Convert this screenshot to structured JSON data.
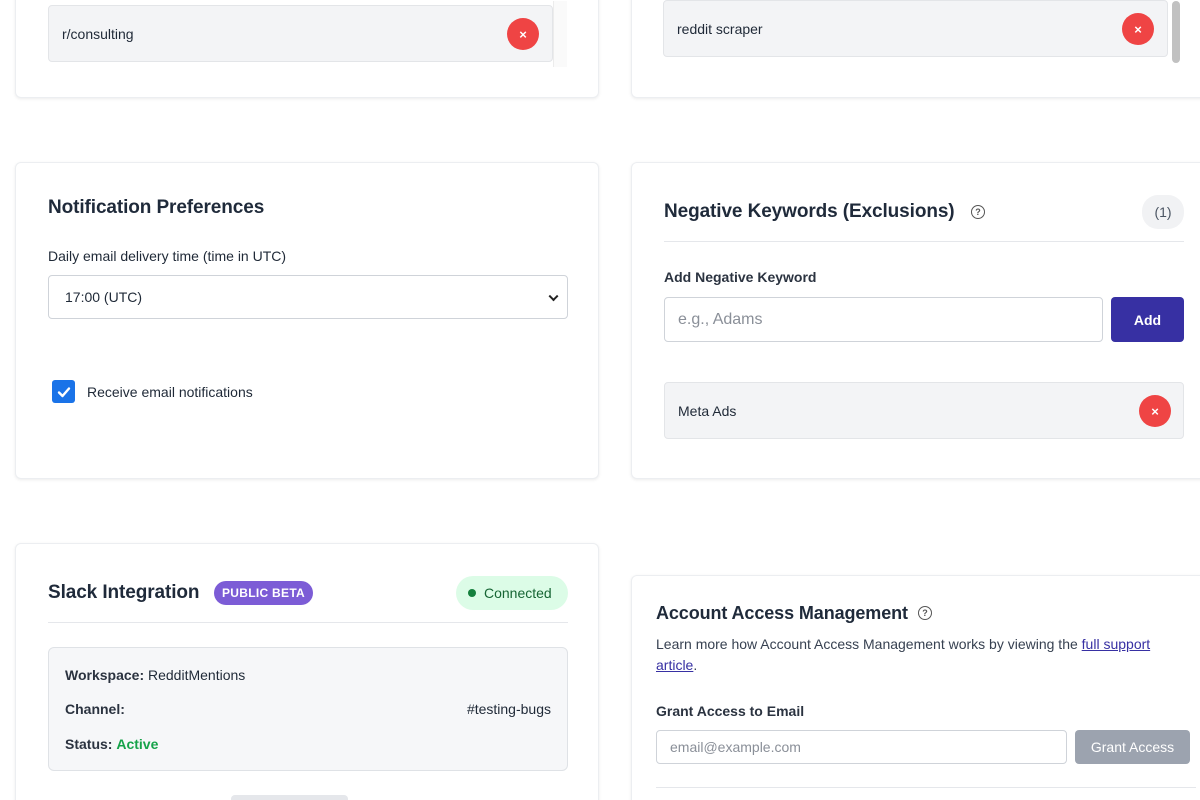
{
  "subreddits": {
    "item": "r/consulting",
    "remove_icon": "×"
  },
  "keywords": {
    "item": "reddit scraper",
    "remove_icon": "×"
  },
  "notifications": {
    "title": "Notification Preferences",
    "time_label": "Daily email delivery time (time in UTC)",
    "time_value": "17:00 (UTC)",
    "checkbox_label": "Receive email notifications",
    "checkbox_checked": true
  },
  "negative_keywords": {
    "title": "Negative Keywords (Exclusions)",
    "help_icon": "?",
    "count": "(1)",
    "add_label": "Add Negative Keyword",
    "input_placeholder": "e.g., Adams",
    "add_button": "Add",
    "item": "Meta Ads",
    "remove_icon": "×"
  },
  "slack": {
    "title": "Slack Integration",
    "badge": "PUBLIC BETA",
    "status_pill": "Connected",
    "workspace_label": "Workspace:",
    "workspace_value": "RedditMentions",
    "channel_label": "Channel:",
    "channel_value": "#testing-bugs",
    "status_label": "Status:",
    "status_value": "Active"
  },
  "account_access": {
    "title": "Account Access Management",
    "help_icon": "?",
    "description": "Learn more how Account Access Management works by viewing the ",
    "link_text": "full support article",
    "description_end": ".",
    "grant_label": "Grant Access to Email",
    "email_placeholder": "email@example.com",
    "grant_button": "Grant Access"
  },
  "colors": {
    "primary": "#3730a3",
    "danger": "#ef4444",
    "success": "#16a34a",
    "beta": "#7c5cd6"
  }
}
